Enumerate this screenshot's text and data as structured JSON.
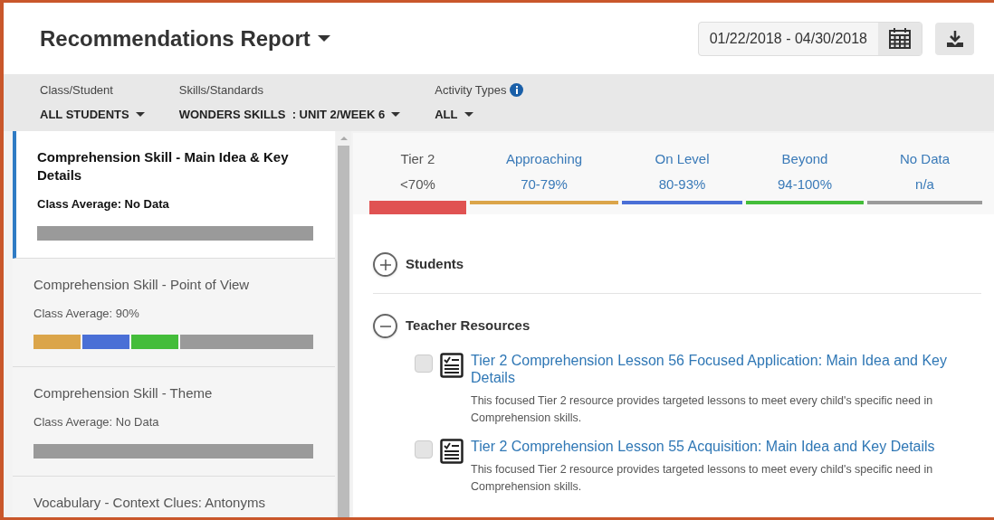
{
  "header": {
    "title": "Recommendations Report",
    "date_range": "01/22/2018 - 04/30/2018"
  },
  "filters": [
    {
      "label": "Class/Student",
      "value": "ALL STUDENTS",
      "info": false
    },
    {
      "label": "Skills/Standards",
      "value": "WONDERS SKILLS  : UNIT 2/WEEK 6",
      "info": false
    },
    {
      "label": "Activity Types",
      "value": "ALL",
      "info": true
    }
  ],
  "skills": [
    {
      "title": "Comprehension Skill - Main Idea & Key Details",
      "average": "Class Average: No Data",
      "selected": true,
      "segments": [
        {
          "kind": "rest",
          "color": "#9a9a9a"
        }
      ]
    },
    {
      "title": "Comprehension Skill - Point of View",
      "average": "Class Average: 90%",
      "selected": false,
      "segments": [
        {
          "kind": "score",
          "color": "#dba54a"
        },
        {
          "kind": "score",
          "color": "#4a6fd6"
        },
        {
          "kind": "score",
          "color": "#44bd3a"
        },
        {
          "kind": "rest",
          "color": "#9a9a9a"
        }
      ]
    },
    {
      "title": "Comprehension Skill - Theme",
      "average": "Class Average: No Data",
      "selected": false,
      "segments": [
        {
          "kind": "rest",
          "color": "#9a9a9a"
        }
      ]
    },
    {
      "title": "Vocabulary - Context Clues: Antonyms",
      "selected": false
    }
  ],
  "tiers": [
    {
      "label": "Tier 2",
      "range": "<70%",
      "color": "#e05252",
      "selected": true
    },
    {
      "label": "Approaching",
      "range": "70-79%",
      "color": "#dba54a",
      "selected": false
    },
    {
      "label": "On Level",
      "range": "80-93%",
      "color": "#4a6fd6",
      "selected": false
    },
    {
      "label": "Beyond",
      "range": "94-100%",
      "color": "#44bd3a",
      "selected": false
    },
    {
      "label": "No Data",
      "range": "n/a",
      "color": "#9a9a9a",
      "selected": false
    }
  ],
  "sections": [
    {
      "title": "Students",
      "expanded": false
    },
    {
      "title": "Teacher Resources",
      "expanded": true,
      "resources": [
        {
          "title": "Tier 2 Comprehension Lesson 56 Focused Application: Main Idea and Key Details",
          "description": "This focused Tier 2 resource provides targeted lessons to meet every child's specific need in Comprehension skills.",
          "checked": false
        },
        {
          "title": "Tier 2 Comprehension Lesson 55 Acquisition: Main Idea and Key Details",
          "description": "This focused Tier 2 resource provides targeted lessons to meet every child's specific need in Comprehension skills.",
          "checked": false
        }
      ]
    }
  ]
}
